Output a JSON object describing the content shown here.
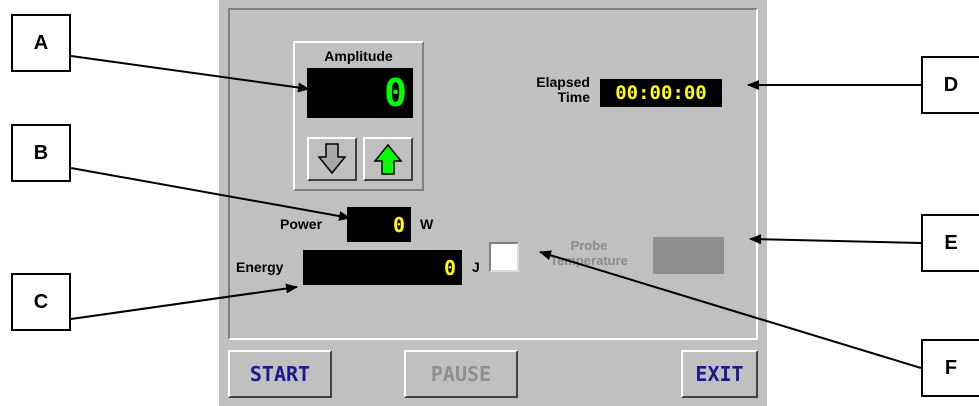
{
  "callouts": {
    "a": "A",
    "b": "B",
    "c": "C",
    "d": "D",
    "e": "E",
    "f": "F"
  },
  "amplitude": {
    "title": "Amplitude",
    "value": "0",
    "down_icon": "arrow-down-icon",
    "up_icon": "arrow-up-icon"
  },
  "elapsed": {
    "label_line1": "Elapsed",
    "label_line2": "Time",
    "value": "00:00:00"
  },
  "power": {
    "label": "Power",
    "value": "0",
    "unit": "W"
  },
  "energy": {
    "label": "Energy",
    "value": "0",
    "unit": "J"
  },
  "probe": {
    "label_line1": "Probe",
    "label_line2": "Temperature",
    "checked": false
  },
  "buttons": {
    "start": "START",
    "pause": "PAUSE",
    "exit": "EXIT"
  },
  "colors": {
    "panel": "#c0c0c0",
    "display_bg": "#000000",
    "display_text": "#ffff00",
    "amplitude_text": "#00ff00",
    "button_text": "#1a1a8c",
    "disabled": "#8f8f8f"
  }
}
